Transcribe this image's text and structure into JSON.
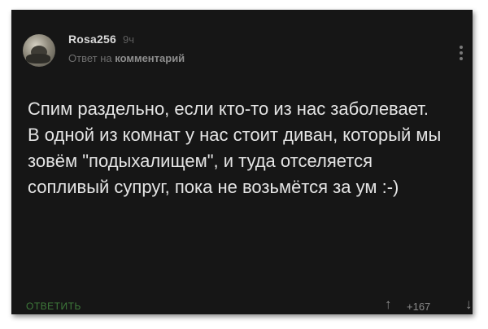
{
  "comment": {
    "author": "Rosa256",
    "time": "9ч",
    "reply_prefix": "Ответ на",
    "reply_link": "комментарий",
    "paragraphs": [
      "Спим раздельно, если кто-то из нас заболевает.",
      "В одной из комнат у нас стоит диван, который мы зовём \"подыхалищем\", и туда отселяется сопливый супруг, пока не возьмётся за ум :-)"
    ]
  },
  "actions": {
    "reply_label": "ОТВЕТИТЬ",
    "score": "+167",
    "up_glyph": "↑",
    "down_glyph": "↓"
  },
  "icons": {
    "avatar": "user-avatar",
    "more": "vertical-dots-icon"
  },
  "colors": {
    "background": "#161616",
    "text": "#e4e4e4",
    "muted": "#6e6e6e",
    "reply_button": "#3e7a3b"
  }
}
